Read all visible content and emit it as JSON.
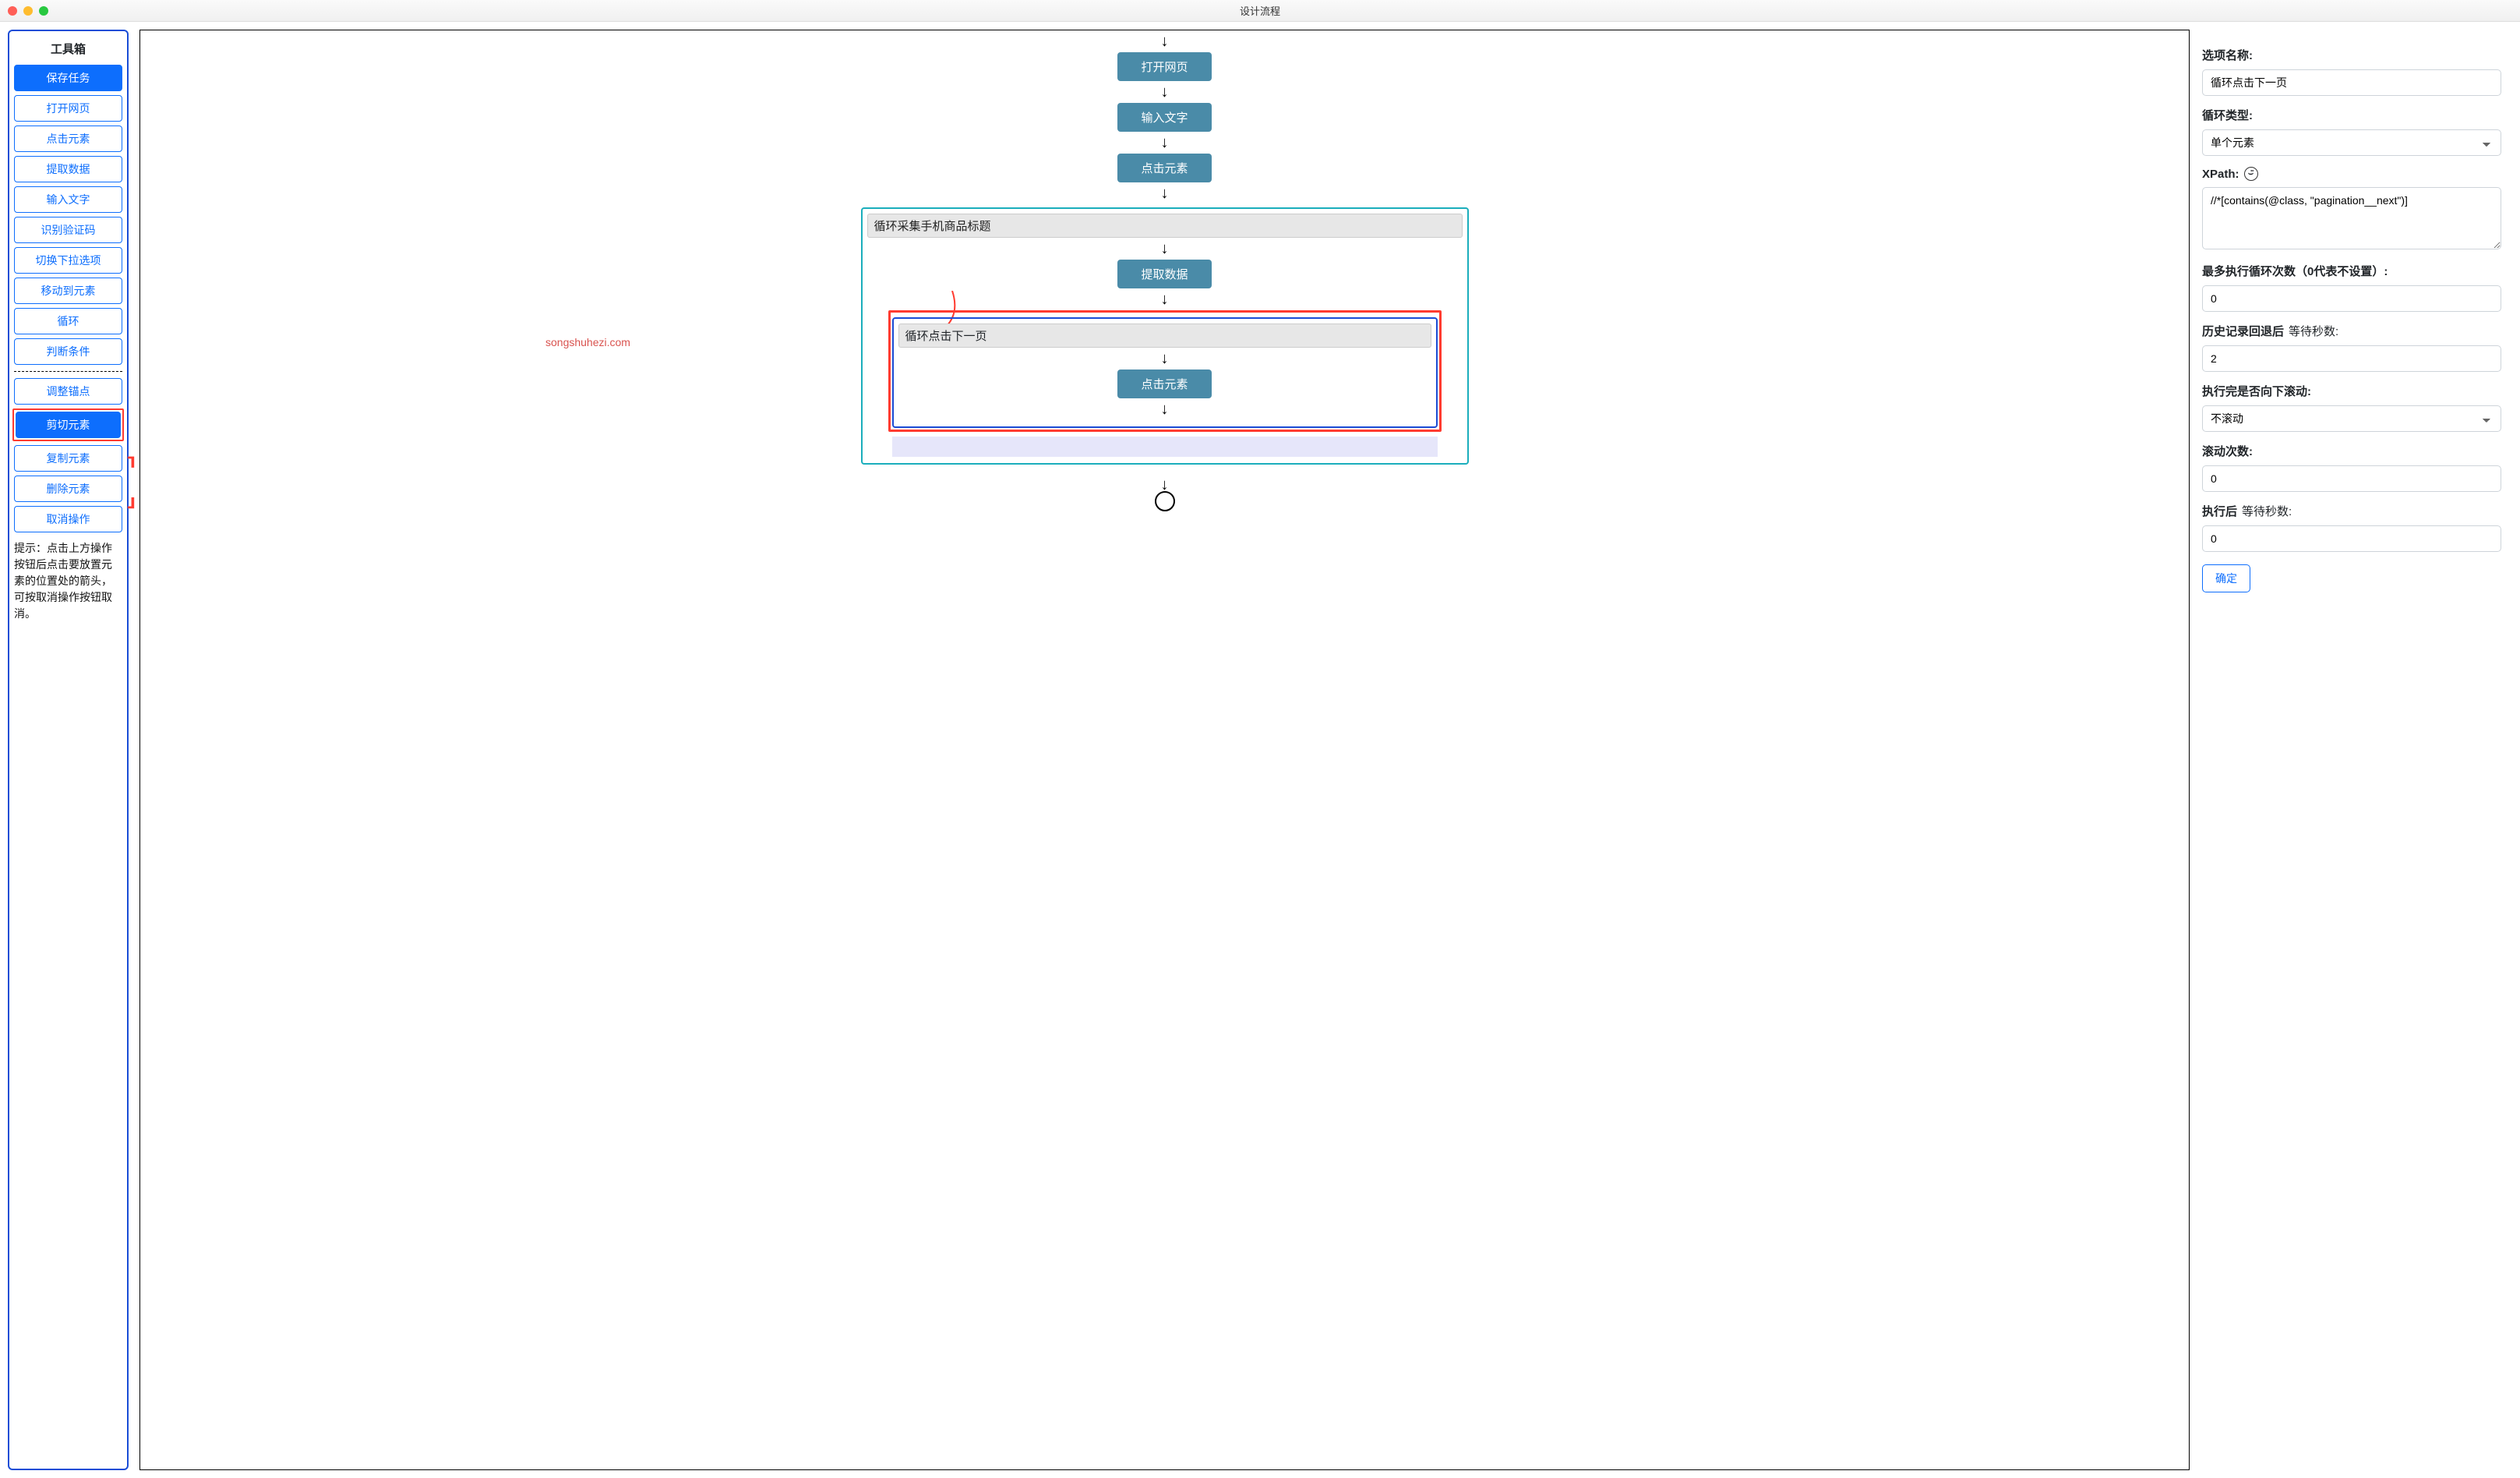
{
  "title": "设计流程",
  "sidebar": {
    "title": "工具箱",
    "buttons": [
      {
        "label": "保存任务",
        "primary": true
      },
      {
        "label": "打开网页"
      },
      {
        "label": "点击元素"
      },
      {
        "label": "提取数据"
      },
      {
        "label": "输入文字"
      },
      {
        "label": "识别验证码"
      },
      {
        "label": "切换下拉选项"
      },
      {
        "label": "移动到元素"
      },
      {
        "label": "循环"
      },
      {
        "label": "判断条件"
      }
    ],
    "edit_buttons": [
      {
        "label": "调整锚点"
      },
      {
        "label": "剪切元素",
        "primary": true,
        "highlighted": true
      },
      {
        "label": "复制元素"
      },
      {
        "label": "删除元素"
      },
      {
        "label": "取消操作"
      }
    ],
    "hint": "提示：点击上方操作按钮后点击要放置元素的位置处的箭头，可按取消操作按钮取消。"
  },
  "canvas": {
    "nodes": [
      "打开网页",
      "输入文字",
      "点击元素"
    ],
    "loop1": {
      "title": "循环采集手机商品标题",
      "node": "提取数据",
      "inner": {
        "title": "循环点击下一页",
        "node": "点击元素"
      }
    },
    "watermark": "songshuhezi.com"
  },
  "form": {
    "option_name_label": "选项名称:",
    "option_name_value": "循环点击下一页",
    "loop_type_label": "循环类型:",
    "loop_type_value": "单个元素",
    "xpath_label": "XPath:",
    "xpath_value": "//*[contains(@class, \"pagination__next\")]",
    "max_loop_label": "最多执行循环次数（0代表不设置）:",
    "max_loop_value": "0",
    "history_wait_label_bold": "历史记录回退后",
    "history_wait_label_plain": "等待秒数:",
    "history_wait_value": "2",
    "scroll_after_label": "执行完是否向下滚动:",
    "scroll_after_value": "不滚动",
    "scroll_count_label": "滚动次数:",
    "scroll_count_value": "0",
    "exec_wait_label_bold": "执行后",
    "exec_wait_label_plain": "等待秒数:",
    "exec_wait_value": "0",
    "confirm": "确定"
  }
}
